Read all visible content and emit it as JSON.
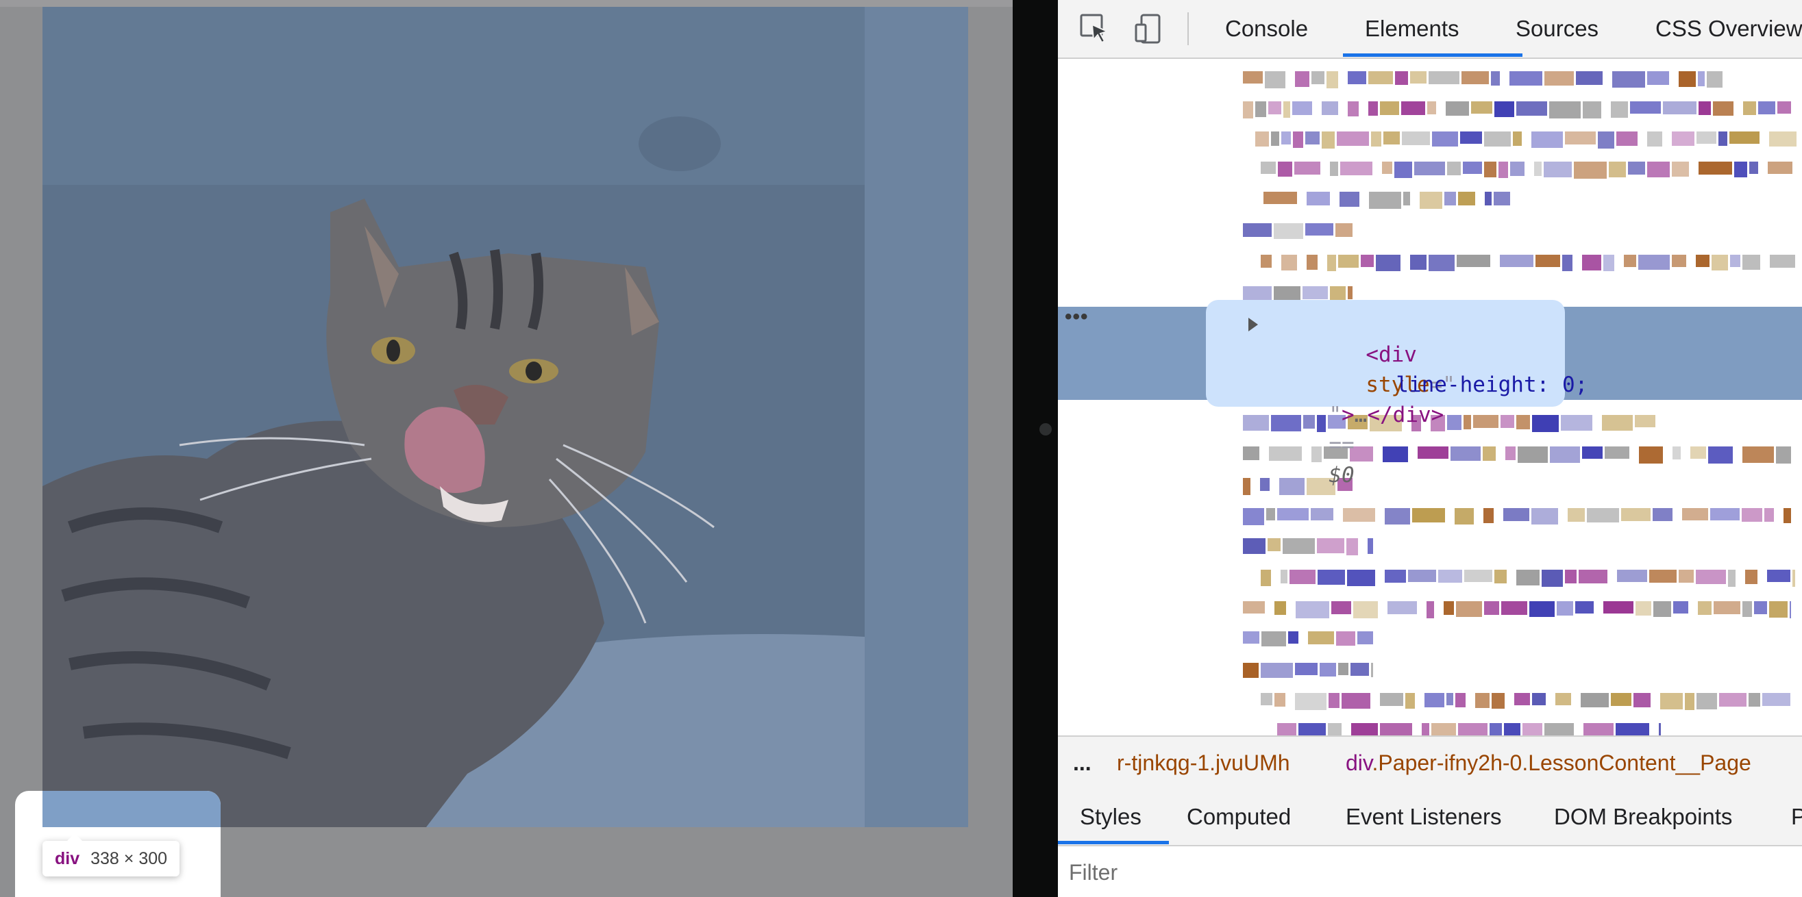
{
  "devtools": {
    "toolbar_tabs": [
      "Console",
      "Elements",
      "Sources",
      "CSS Overview"
    ],
    "active_tab": "Elements",
    "selected_node": {
      "open_tag": "<div",
      "attr_name": "style",
      "attr_open": "=\"",
      "style_decl": "line-height: 0;",
      "close_line_quote": "\"",
      "close_tag_start": ">",
      "ellipsis": "…",
      "close_tag": "</div>",
      "equals": "==",
      "console_ref": "$0"
    },
    "row_menu_dots": "•••",
    "breadcrumb": {
      "more": "...",
      "item_1": "r-tjnkqg-1.jvuUMh",
      "item_2_tag": "div",
      "item_2_class": ".Paper-ifny2h-0.LessonContent__Page"
    },
    "styles_tabs": [
      "Styles",
      "Computed",
      "Event Listeners",
      "DOM Breakpoints",
      "P"
    ],
    "active_styles_tab": "Styles",
    "filter_placeholder": "Filter"
  },
  "inspector_tooltip": {
    "tag": "div",
    "size": "338 × 300"
  },
  "colors": {
    "element_highlight": "#7f9cc1",
    "callout_bg": "#cde2fc",
    "active_tab_underline": "#1a73e8",
    "tag_color": "#881280",
    "attr_color": "#994500",
    "value_color": "#1a1aa6"
  },
  "icons": [
    "inspect-element-icon",
    "device-toolbar-icon"
  ]
}
